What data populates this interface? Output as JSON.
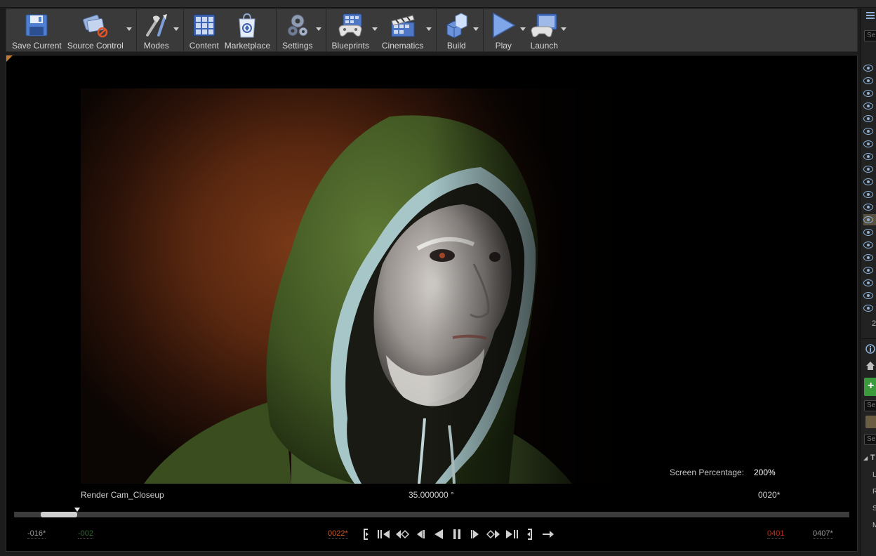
{
  "toolbar": {
    "items": [
      {
        "label": "Save Current",
        "icon": "save-icon",
        "dropdown": false
      },
      {
        "label": "Source Control",
        "icon": "source-control-icon",
        "dropdown": true
      },
      {
        "label": "Modes",
        "icon": "modes-icon",
        "dropdown": true
      },
      {
        "label": "Content",
        "icon": "content-icon",
        "dropdown": false
      },
      {
        "label": "Marketplace",
        "icon": "marketplace-icon",
        "dropdown": false
      },
      {
        "label": "Settings",
        "icon": "settings-icon",
        "dropdown": true
      },
      {
        "label": "Blueprints",
        "icon": "blueprints-icon",
        "dropdown": true
      },
      {
        "label": "Cinematics",
        "icon": "cinematics-icon",
        "dropdown": true
      },
      {
        "label": "Build",
        "icon": "build-icon",
        "dropdown": true
      },
      {
        "label": "Play",
        "icon": "play-icon",
        "dropdown": true
      },
      {
        "label": "Launch",
        "icon": "launch-icon",
        "dropdown": true
      }
    ]
  },
  "viewport": {
    "camera_name": "Render  Cam_Closeup",
    "fov": "35.000000 °",
    "frame": "0020*",
    "screen_percentage_label": "Screen Percentage:",
    "screen_percentage_value": "200%"
  },
  "sequencer": {
    "start": "-016*",
    "in": "-002",
    "current": "0022*",
    "out": "0401",
    "end": "0407*",
    "playhead_fraction": 0.076,
    "in_fraction": 0.032
  },
  "right_panel": {
    "search_placeholder": "Se",
    "count_text": "2",
    "add_symbol": "+",
    "details_search_1": "Se",
    "details_search_2": "Se",
    "section_arrow": "◢",
    "section_label": "T",
    "row_letters": [
      "L",
      "R",
      "S",
      "M"
    ]
  },
  "colors": {
    "accent": "#c2782e",
    "add_green": "#3b9a3b",
    "eye_blue": "#8fb3d9"
  }
}
